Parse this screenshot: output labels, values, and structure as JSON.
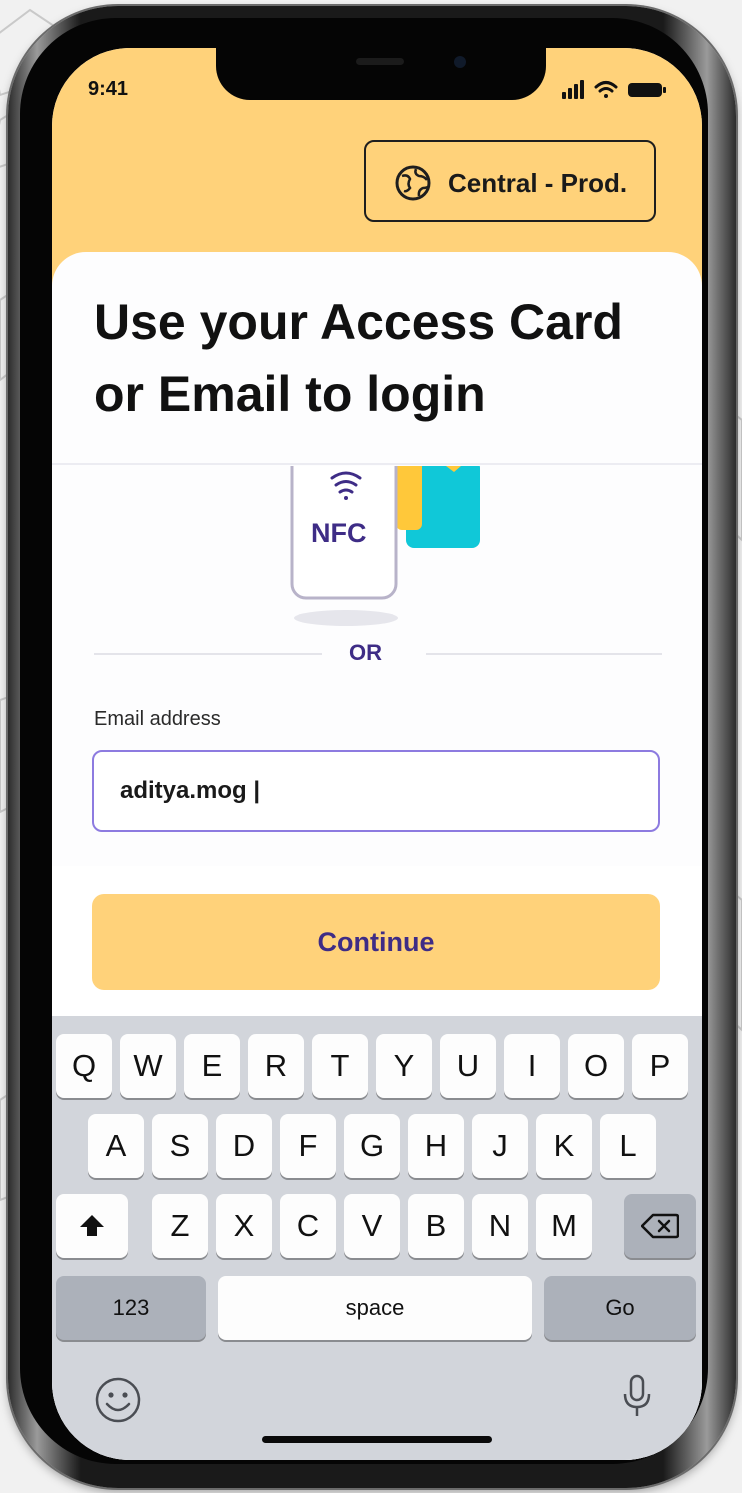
{
  "status_bar": {
    "time": "9:41",
    "icons": [
      "signal-icon",
      "wifi-icon",
      "battery-icon"
    ]
  },
  "region": {
    "label": "Central - Prod.",
    "icon": "globe-icon"
  },
  "headline": "Use your Access Card or Email to login",
  "nfc": {
    "label": "NFC",
    "icon": "contactless-icon"
  },
  "divider_label": "OR",
  "email": {
    "label": "Email address",
    "value": "aditya.mog |"
  },
  "continue_label": "Continue",
  "keyboard": {
    "row1": [
      "Q",
      "W",
      "E",
      "R",
      "T",
      "Y",
      "U",
      "I",
      "O",
      "P"
    ],
    "row2": [
      "A",
      "S",
      "D",
      "F",
      "G",
      "H",
      "J",
      "K",
      "L"
    ],
    "row3": [
      "Z",
      "X",
      "C",
      "V",
      "B",
      "N",
      "M"
    ],
    "shift_icon": "shift-icon",
    "delete_icon": "delete-icon",
    "numbers_label": "123",
    "space_label": "space",
    "go_label": "Go",
    "emoji_icon": "emoji-icon",
    "mic_icon": "microphone-icon"
  },
  "colors": {
    "brand_yellow": "#ffd27a",
    "brand_purple": "#3e2c86",
    "input_border": "#8d7be0"
  }
}
